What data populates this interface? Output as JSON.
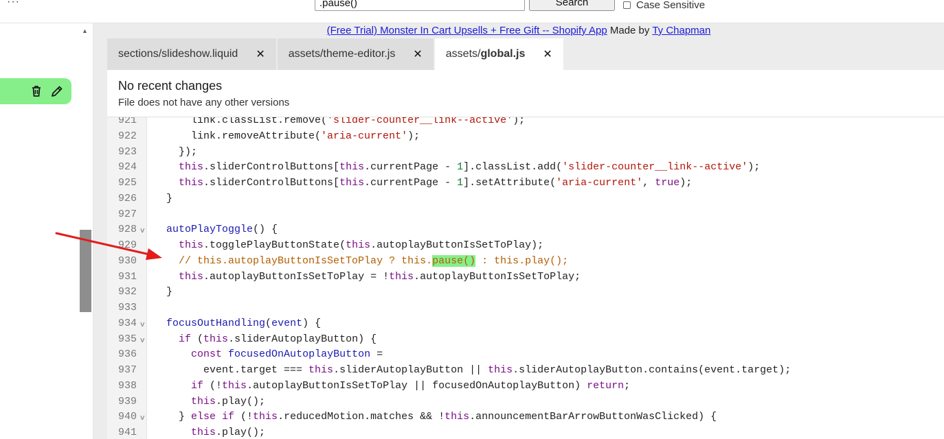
{
  "toolbar": {
    "search_value": ".pause()",
    "search_button_label": "Search",
    "case_sensitive_label": "Case Sensitive",
    "menu_icon": "ellipsis-icon"
  },
  "sidebar": {
    "delete_icon": "trash-icon",
    "edit_icon": "pencil-icon",
    "accent_color": "#86ef8a"
  },
  "promo": {
    "link_text": "(Free Trial) Monster In Cart Upsells + Free Gift -- Shopify App",
    "made_by": "Made by",
    "author_link": "Ty Chapman"
  },
  "tabs": [
    {
      "prefix": "sections/slideshow.liquid",
      "strong": "",
      "active": false
    },
    {
      "prefix": "assets/theme-editor.js",
      "strong": "",
      "active": false
    },
    {
      "prefix": "assets/",
      "strong": "global.js",
      "active": true
    }
  ],
  "history": {
    "title": "No recent changes",
    "subtitle": "File does not have any other versions"
  },
  "code_lines": [
    {
      "n": "921",
      "fold": "",
      "html": "      link.classList.remove(<span class=\"str\">'slider-counter__link--active'</span>);"
    },
    {
      "n": "922",
      "fold": "",
      "html": "      link.removeAttribute(<span class=\"str\">'aria-current'</span>);"
    },
    {
      "n": "923",
      "fold": "",
      "html": "    });"
    },
    {
      "n": "924",
      "fold": "",
      "html": "    <span class=\"kw\">this</span>.sliderControlButtons[<span class=\"kw\">this</span>.currentPage - <span class=\"num\">1</span>].classList.add(<span class=\"str\">'slider-counter__link--active'</span>);"
    },
    {
      "n": "925",
      "fold": "",
      "html": "    <span class=\"kw\">this</span>.sliderControlButtons[<span class=\"kw\">this</span>.currentPage - <span class=\"num\">1</span>].setAttribute(<span class=\"str\">'aria-current'</span>, <span class=\"kw\">true</span>);"
    },
    {
      "n": "926",
      "fold": "",
      "html": "  }"
    },
    {
      "n": "927",
      "fold": "",
      "html": ""
    },
    {
      "n": "928",
      "fold": "v",
      "html": "  <span class=\"fn\">autoPlayToggle</span>() {"
    },
    {
      "n": "929",
      "fold": "",
      "html": "    <span class=\"kw\">this</span>.togglePlayButtonState(<span class=\"kw\">this</span>.autoplayButtonIsSetToPlay);"
    },
    {
      "n": "930",
      "fold": "",
      "html": "    <span class=\"cmt\">// this.autoplayButtonIsSetToPlay ? this.<span class=\"hl\">pause()</span> : this.play();</span>"
    },
    {
      "n": "931",
      "fold": "",
      "html": "    <span class=\"kw\">this</span>.autoplayButtonIsSetToPlay = !<span class=\"kw\">this</span>.autoplayButtonIsSetToPlay;"
    },
    {
      "n": "932",
      "fold": "",
      "html": "  }"
    },
    {
      "n": "933",
      "fold": "",
      "html": ""
    },
    {
      "n": "934",
      "fold": "v",
      "html": "  <span class=\"fn\">focusOutHandling</span>(<span class=\"fn\">event</span>) {"
    },
    {
      "n": "935",
      "fold": "v",
      "html": "    <span class=\"kw\">if</span> (<span class=\"kw\">this</span>.sliderAutoplayButton) {"
    },
    {
      "n": "936",
      "fold": "",
      "html": "      <span class=\"kw\">const</span> <span class=\"fn\">focusedOnAutoplayButton</span> ="
    },
    {
      "n": "937",
      "fold": "",
      "html": "        event.target === <span class=\"kw\">this</span>.sliderAutoplayButton || <span class=\"kw\">this</span>.sliderAutoplayButton.contains(event.target);"
    },
    {
      "n": "938",
      "fold": "",
      "html": "      <span class=\"kw\">if</span> (!<span class=\"kw\">this</span>.autoplayButtonIsSetToPlay || focusedOnAutoplayButton) <span class=\"kw\">return</span>;"
    },
    {
      "n": "939",
      "fold": "",
      "html": "      <span class=\"kw\">this</span>.play();"
    },
    {
      "n": "940",
      "fold": "v",
      "html": "    } <span class=\"kw\">else if</span> (!<span class=\"kw\">this</span>.reducedMotion.matches &amp;&amp; !<span class=\"kw\">this</span>.announcementBarArrowButtonWasClicked) {"
    },
    {
      "n": "941",
      "fold": "",
      "html": "      <span class=\"kw\">this</span>.play();"
    }
  ]
}
